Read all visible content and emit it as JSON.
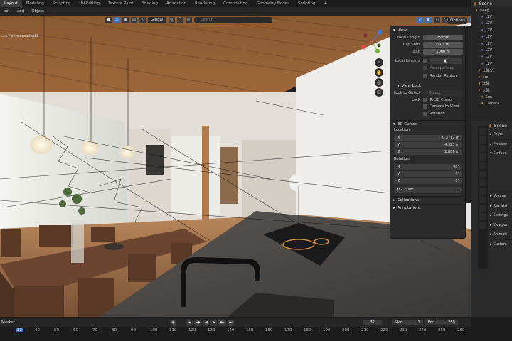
{
  "workspaces": [
    "Layout",
    "Modeling",
    "Sculpting",
    "UV Editing",
    "Texture Paint",
    "Shading",
    "Animation",
    "Rendering",
    "Compositing",
    "Geometry Nodes",
    "Scripting",
    "+"
  ],
  "active_workspace": "Layout",
  "header_menu": [
    "ect",
    "Add",
    "Object"
  ],
  "transform_orientation": "Global",
  "search_placeholder": "Search",
  "options_label": "Options",
  "camera_label": "...s / cemeralelet8l",
  "npanel": {
    "view_title": "View",
    "focal_length_label": "Focal Length",
    "focal_length": "25 mm",
    "clip_start_label": "Clip Start",
    "clip_start": "0.01 m",
    "clip_end_label": "End",
    "clip_end": "1000 m",
    "local_camera_label": "Local Camera",
    "passepartout_label": "Passepartout",
    "render_region_label": "Render Region",
    "view_lock_title": "View Lock",
    "lock_to_object_label": "Lock to Object",
    "object_placeholder": "Object",
    "lock_label": "Lock",
    "to_3d_cursor_label": "To 3D Cursor",
    "camera_to_view_label": "Camera to View",
    "rotation_lock_label": "Rotation",
    "cursor_title": "3D Cursor",
    "location_label": "Location:",
    "loc_x_label": "X",
    "loc_x": "0.3717 m",
    "loc_y_label": "Y",
    "loc_y": "-4.323 m",
    "loc_z_label": "Z",
    "loc_z": "2.886 m",
    "rotation_label": "Rotation:",
    "rot_x_label": "X",
    "rot_x": "90°",
    "rot_y_label": "Y",
    "rot_y": "0°",
    "rot_z_label": "Z",
    "rot_z": "0°",
    "rotation_mode": "XYZ Euler",
    "collections_title": "Collections",
    "annotations_title": "Annotations"
  },
  "outliner": {
    "title": "Scene",
    "items": [
      "living",
      "L2V",
      "L2V",
      "L2V",
      "L2V",
      "L2V",
      "L2V",
      "L2V",
      "L2V",
      "太陽光",
      "are",
      "太陽",
      "太陽",
      "Sun",
      "Camera"
    ]
  },
  "properties": {
    "scene_label": "Scene",
    "panels": [
      "Physi",
      "Preview",
      "Surface",
      "Volume",
      "Ray Visi",
      "Settings",
      "Viewport",
      "Animati",
      "Custom"
    ]
  },
  "timeline": {
    "marker_label": "Marker",
    "current_frame": "32",
    "start_label": "Start",
    "start": "1",
    "end_label": "End",
    "end": "250",
    "ruler_ticks": [
      "32",
      "40",
      "50",
      "60",
      "70",
      "80",
      "90",
      "100",
      "110",
      "120",
      "130",
      "140",
      "150",
      "160",
      "170",
      "180",
      "190",
      "200",
      "210",
      "220",
      "230",
      "240",
      "250",
      "260"
    ]
  }
}
